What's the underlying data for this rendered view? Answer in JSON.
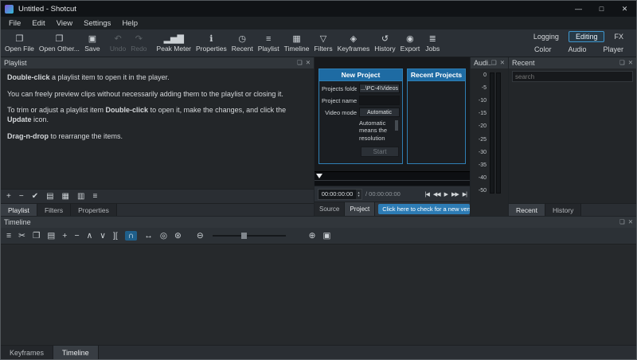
{
  "window": {
    "title": "Untitled - Shotcut",
    "minimize": "—",
    "maximize": "□",
    "close": "✕"
  },
  "menubar": {
    "items": [
      "File",
      "Edit",
      "View",
      "Settings",
      "Help"
    ]
  },
  "toolbar": {
    "buttons": [
      {
        "label": "Open File",
        "glyph": "❒"
      },
      {
        "label": "Open Other...",
        "glyph": "❐"
      },
      {
        "label": "Save",
        "glyph": "▣"
      },
      {
        "label": "Undo",
        "glyph": "↶"
      },
      {
        "label": "Redo",
        "glyph": "↷"
      },
      {
        "label": "Peak Meter",
        "glyph": "▂▅▇"
      },
      {
        "label": "Properties",
        "glyph": "ℹ"
      },
      {
        "label": "Recent",
        "glyph": "◷"
      },
      {
        "label": "Playlist",
        "glyph": "≡"
      },
      {
        "label": "Timeline",
        "glyph": "▦"
      },
      {
        "label": "Filters",
        "glyph": "▽"
      },
      {
        "label": "Keyframes",
        "glyph": "◈"
      },
      {
        "label": "History",
        "glyph": "↺"
      },
      {
        "label": "Export",
        "glyph": "◉"
      },
      {
        "label": "Jobs",
        "glyph": "≣"
      }
    ],
    "layout_row1": [
      "Logging",
      "Editing",
      "FX"
    ],
    "layout_row2": [
      "Color",
      "Audio",
      "Player"
    ],
    "active_layout": "Editing"
  },
  "panel_icons": {
    "float": "❏",
    "close": "✕"
  },
  "playlist": {
    "title": "Playlist",
    "help": {
      "l1b": "Double-click",
      "l1r": " a playlist item to open it in the player.",
      "l2": "You can freely preview clips without necessarily adding them to the playlist or closing it.",
      "l3a": "To trim or adjust a playlist item ",
      "l3b": "Double-click",
      "l3c": " to open it, make the changes, and click the ",
      "l3d": "Update",
      "l3e": " icon.",
      "l4b": "Drag-n-drop",
      "l4r": " to rearrange the items."
    },
    "tools": [
      {
        "name": "add",
        "glyph": "+"
      },
      {
        "name": "remove",
        "glyph": "−"
      },
      {
        "name": "update",
        "glyph": "✔"
      },
      {
        "name": "view-details",
        "glyph": "▤"
      },
      {
        "name": "view-icons",
        "glyph": "▦"
      },
      {
        "name": "view-tiles",
        "glyph": "▥"
      },
      {
        "name": "menu",
        "glyph": "≡"
      }
    ],
    "tabs": [
      "Playlist",
      "Filters",
      "Properties"
    ],
    "active_tab": "Playlist"
  },
  "project_dialog": {
    "new_title": "New Project",
    "recent_title": "Recent Projects",
    "folder_label": "Projects folder",
    "folder_value": "...\\PC-4\\Videos",
    "name_label": "Project name",
    "name_value": "",
    "mode_label": "Video mode",
    "mode_value": "Automatic",
    "description": "Automatic means the resolution",
    "start_label": "Start"
  },
  "player": {
    "current_time": "00:00:00:00",
    "total_time": "/ 00:00:00:00",
    "spin_up": "▴",
    "spin_down": "▾",
    "transport": [
      {
        "name": "skip-to-start",
        "glyph": "|◀"
      },
      {
        "name": "rewind",
        "glyph": "◀◀"
      },
      {
        "name": "play",
        "glyph": "▶"
      },
      {
        "name": "fast-forward",
        "glyph": "▶▶"
      },
      {
        "name": "skip-to-end",
        "glyph": "▶|"
      }
    ],
    "tabs": [
      "Source",
      "Project"
    ],
    "active_tab": "Project",
    "update_button": "Click here to check for a new versi..."
  },
  "audio_meter": {
    "title": "Audi...",
    "scale": [
      "0",
      "-5",
      "-10",
      "-15",
      "-20",
      "-25",
      "-30",
      "-35",
      "-40",
      "-50"
    ]
  },
  "recent_panel": {
    "title": "Recent",
    "search_placeholder": "search",
    "tabs": [
      "Recent",
      "History"
    ],
    "active_tab": "Recent"
  },
  "timeline": {
    "title": "Timeline",
    "tools": [
      {
        "name": "timeline-menu",
        "glyph": "≡"
      },
      {
        "name": "cut",
        "glyph": "✂"
      },
      {
        "name": "copy",
        "glyph": "❐"
      },
      {
        "name": "paste",
        "glyph": "▤"
      },
      {
        "name": "append",
        "glyph": "+"
      },
      {
        "name": "ripple-delete",
        "glyph": "−"
      },
      {
        "name": "lift",
        "glyph": "∧"
      },
      {
        "name": "overwrite",
        "glyph": "∨"
      },
      {
        "name": "split",
        "glyph": "]["
      },
      {
        "name": "snap",
        "glyph": "∩"
      },
      {
        "name": "scrub-while-dragging",
        "glyph": "↔"
      },
      {
        "name": "ripple",
        "glyph": "◎"
      },
      {
        "name": "ripple-all-tracks",
        "glyph": "⊛"
      },
      {
        "name": "zoom-out",
        "glyph": "⊖"
      },
      {
        "name": "zoom-in",
        "glyph": "⊕"
      },
      {
        "name": "zoom-fit",
        "glyph": "▣"
      }
    ]
  },
  "bottom_tabs": [
    "Keyframes",
    "Timeline"
  ],
  "colors": {
    "accent": "#3daee9",
    "header_blue": "#1e6ba3",
    "button_blue": "#2d7cb5"
  }
}
